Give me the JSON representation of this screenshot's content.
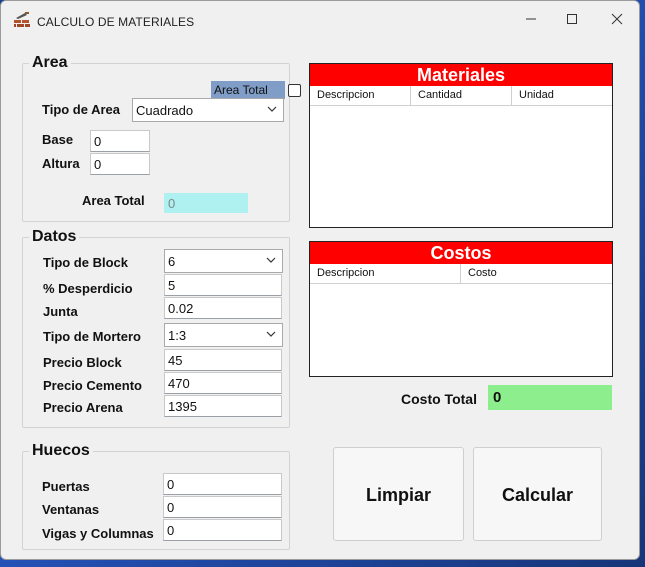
{
  "window": {
    "title": "CALCULO DE MATERIALES"
  },
  "area": {
    "legend": "Area",
    "area_total_check_label": "Area Total",
    "area_total_checked": false,
    "tipo_label": "Tipo de Area",
    "tipo_value": "Cuadrado",
    "base_label": "Base",
    "base_value": "0",
    "altura_label": "Altura",
    "altura_value": "0",
    "total_label": "Area Total",
    "total_value": "0"
  },
  "datos": {
    "legend": "Datos",
    "tipo_block_label": "Tipo de Block",
    "tipo_block_value": "6",
    "desperdicio_label": "% Desperdicio",
    "desperdicio_value": "5",
    "junta_label": "Junta",
    "junta_value": "0.02",
    "tipo_mortero_label": "Tipo de Mortero",
    "tipo_mortero_value": "1:3",
    "precio_block_label": "Precio Block",
    "precio_block_value": "45",
    "precio_cemento_label": "Precio Cemento",
    "precio_cemento_value": "470",
    "precio_arena_label": "Precio Arena",
    "precio_arena_value": "1395"
  },
  "huecos": {
    "legend": "Huecos",
    "puertas_label": "Puertas",
    "puertas_value": "0",
    "ventanas_label": "Ventanas",
    "ventanas_value": "0",
    "vigas_label": "Vigas y Columnas",
    "vigas_value": "0"
  },
  "materiales": {
    "title": "Materiales",
    "columns": [
      "Descripcion",
      "Cantidad",
      "Unidad"
    ],
    "rows": []
  },
  "costos": {
    "title": "Costos",
    "columns": [
      "Descripcion",
      "Costo"
    ],
    "rows": []
  },
  "costo_total": {
    "label": "Costo Total",
    "value": "0"
  },
  "buttons": {
    "limpiar": "Limpiar",
    "calcular": "Calcular"
  },
  "colors": {
    "panel_header": "#ff0000",
    "total_box": "#8cee8c",
    "readonly_box": "#aff0f0",
    "checkbox_bg": "#7f9dc6"
  }
}
